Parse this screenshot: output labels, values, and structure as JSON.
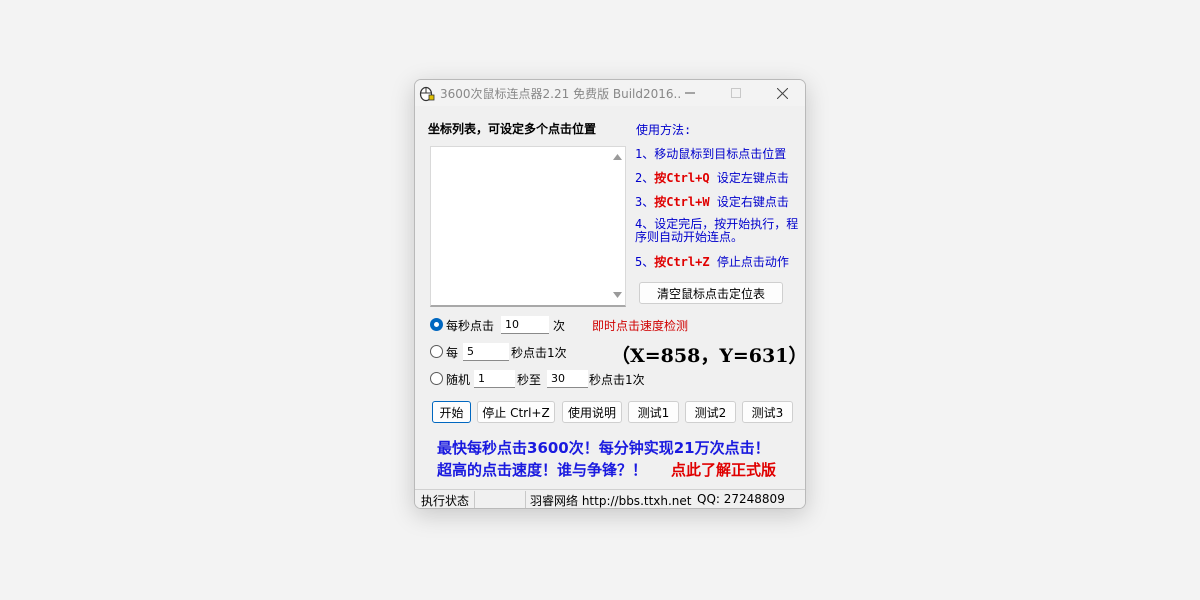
{
  "window": {
    "title": "3600次鼠标连点器2.21 免费版 Build2016...."
  },
  "left": {
    "list_heading": "坐标列表，可设定多个点击位置"
  },
  "help": {
    "title": "使用方法:",
    "step1": "1、移动鼠标到目标点击位置",
    "step2_prefix": "2、",
    "step2_key": "按Ctrl+Q",
    "step2_suffix": " 设定左键点击",
    "step3_prefix": "3、",
    "step3_key": "按Ctrl+W",
    "step3_suffix": " 设定右键点击",
    "step4": "4、设定完后，按开始执行，程序则自动开始连点。",
    "step5_prefix": "5、",
    "step5_key": "按Ctrl+Z",
    "step5_suffix": " 停止点击动作",
    "clear_button": "清空鼠标点击定位表"
  },
  "modes": {
    "per_second_label": "每秒点击",
    "per_second_value": "10",
    "per_second_unit": "次",
    "speed_test_link": "即时点击速度检测",
    "every_label": "每",
    "every_value": "5",
    "every_unit": "秒点击1次",
    "coords": "（X=858，Y=631）",
    "random_label": "随机",
    "random_min": "1",
    "random_mid": "秒至",
    "random_max": "30",
    "random_unit": "秒点击1次",
    "selected": "per_second"
  },
  "buttons": {
    "start": "开始",
    "stop": "停止 Ctrl+Z",
    "manual": "使用说明",
    "test1": "测试1",
    "test2": "测试2",
    "test3": "测试3"
  },
  "promo": {
    "line1": "最快每秒点击3600次！每分钟实现21万次点击！",
    "line2": "超高的点击速度！谁与争锋？！",
    "link": "点此了解正式版"
  },
  "status": {
    "state": "执行状态",
    "site": "羽睿网络 http://bbs.ttxh.net",
    "qq": "QQ:  27248809"
  },
  "colors": {
    "accent": "#0067c0",
    "help_text": "#0000cc",
    "key_red": "#e00000",
    "promo_blue": "#1a1adf",
    "promo_red": "#e00000"
  }
}
